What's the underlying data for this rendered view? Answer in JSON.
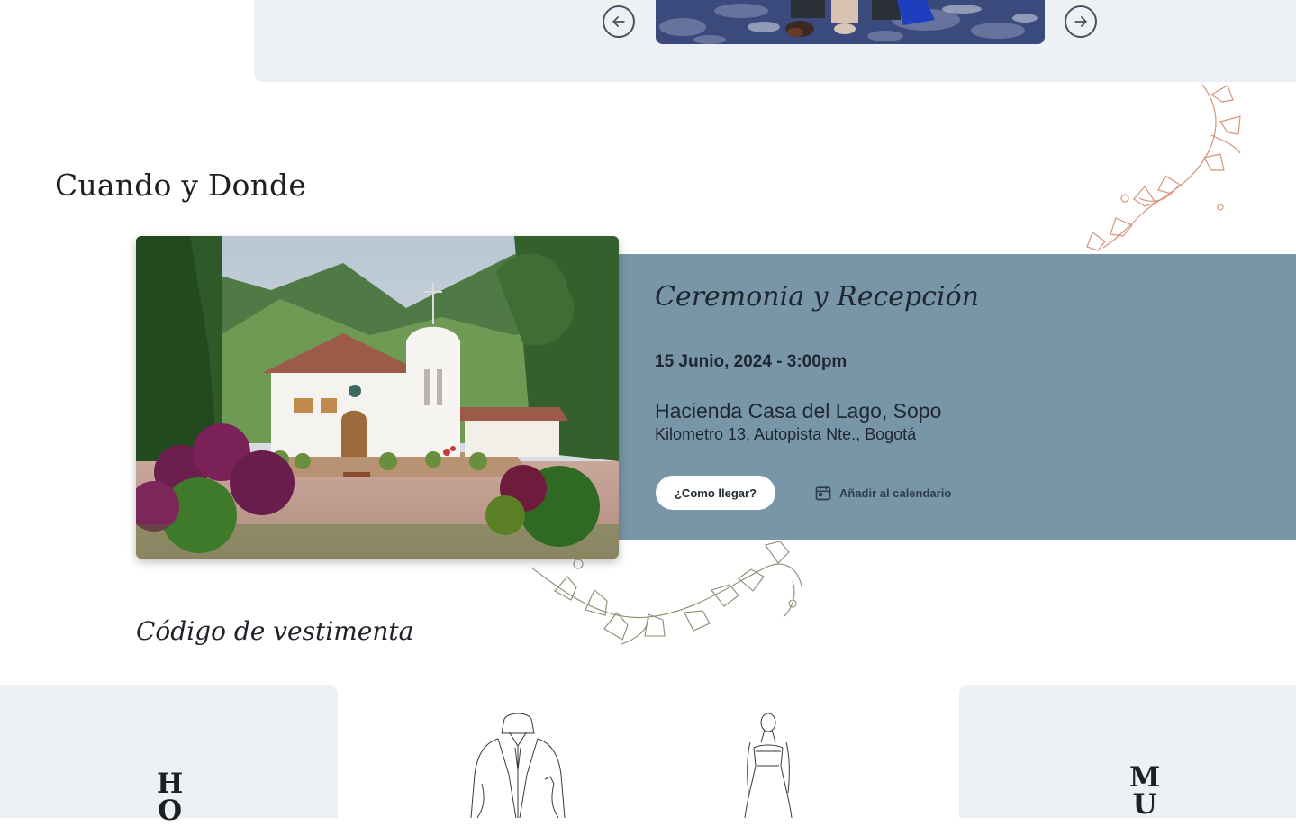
{
  "carousel": {
    "prev_label": "Anterior",
    "next_label": "Siguiente"
  },
  "when_where": {
    "section_title": "Cuando y Donde",
    "event_title": "Ceremonia y Recepción",
    "event_date": "15 Junio, 2024 - 3:00pm",
    "venue_name": "Hacienda Casa del Lago, Sopo",
    "venue_address": "Kilometro 13, Autopista Nte., Bogotá",
    "directions_button": "¿Como llegar?",
    "calendar_button": "Añadir al calendario"
  },
  "dress_code": {
    "title": "Código de vestimenta",
    "men_letters": [
      "H",
      "O"
    ],
    "women_letters": [
      "M",
      "U"
    ]
  },
  "colors": {
    "band": "#eef1f4",
    "info_panel": "#7896a8",
    "vine_rose": "#d8927c",
    "vine_olive": "#8b8a73"
  },
  "icons": {
    "prev": "arrow-left-circle-icon",
    "next": "arrow-right-circle-icon",
    "calendar": "calendar-icon"
  }
}
